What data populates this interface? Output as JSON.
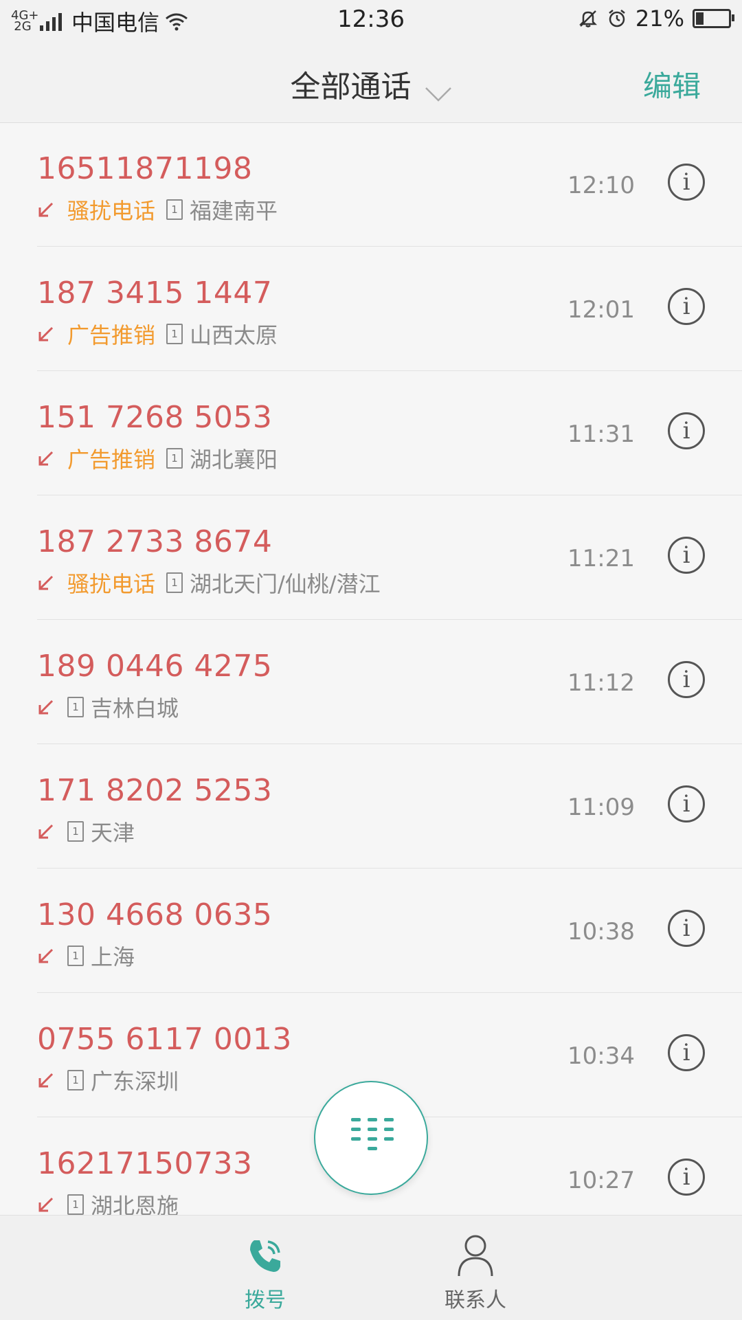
{
  "status_bar": {
    "network_top": "4G+",
    "network_bottom": "2G",
    "carrier": "中国电信",
    "time": "12:36",
    "battery_percent": "21%",
    "battery_level": 0.21
  },
  "header": {
    "title": "全部通话",
    "edit_label": "编辑"
  },
  "calls": [
    {
      "number": "16511871198",
      "tag": "骚扰电话",
      "sim": "1",
      "location": "福建南平",
      "time": "12:10"
    },
    {
      "number": "187 3415 1447",
      "tag": "广告推销",
      "sim": "1",
      "location": "山西太原",
      "time": "12:01"
    },
    {
      "number": "151 7268 5053",
      "tag": "广告推销",
      "sim": "1",
      "location": "湖北襄阳",
      "time": "11:31"
    },
    {
      "number": "187 2733 8674",
      "tag": "骚扰电话",
      "sim": "1",
      "location": "湖北天门/仙桃/潜江",
      "time": "11:21"
    },
    {
      "number": "189 0446 4275",
      "tag": "",
      "sim": "1",
      "location": "吉林白城",
      "time": "11:12"
    },
    {
      "number": "171 8202 5253",
      "tag": "",
      "sim": "1",
      "location": "天津",
      "time": "11:09"
    },
    {
      "number": "130 4668 0635",
      "tag": "",
      "sim": "1",
      "location": "上海",
      "time": "10:38"
    },
    {
      "number": "0755 6117 0013",
      "tag": "",
      "sim": "1",
      "location": "广东深圳",
      "time": "10:34"
    },
    {
      "number": "16217150733",
      "tag": "",
      "sim": "1",
      "location": "湖北恩施",
      "time": "10:27"
    }
  ],
  "colors": {
    "accent": "#3aa99b",
    "missed_call_red": "#d45c5c",
    "tag_orange": "#f29a2e"
  },
  "bottom_nav": {
    "dial_label": "拨号",
    "contacts_label": "联系人"
  }
}
